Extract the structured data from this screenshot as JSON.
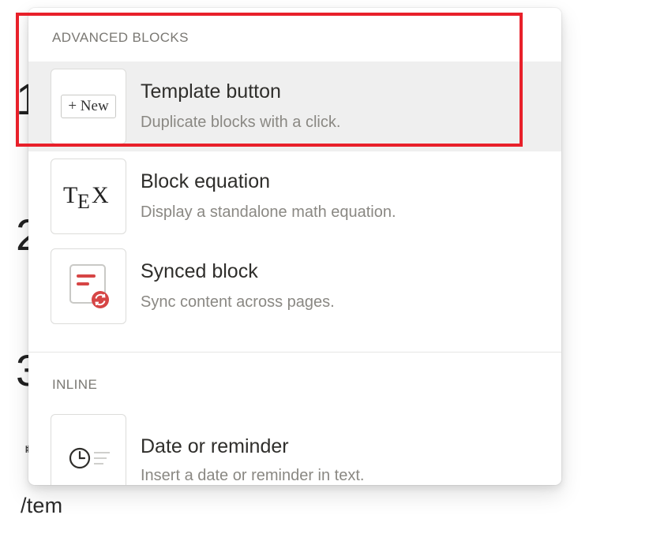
{
  "background": {
    "glyphs": [
      "1",
      "2",
      "3"
    ],
    "small_glyph": "ᅤ",
    "typed_text": "/tem"
  },
  "menu": {
    "sections": [
      {
        "header": "ADVANCED BLOCKS",
        "items": [
          {
            "title": "Template button",
            "description": "Duplicate blocks with a click.",
            "icon": "template-button-icon",
            "icon_text": "+ New",
            "selected": true
          },
          {
            "title": "Block equation",
            "description": "Display a standalone math equation.",
            "icon": "tex-equation-icon",
            "icon_text": "TEX",
            "selected": false
          },
          {
            "title": "Synced block",
            "description": "Sync content across pages.",
            "icon": "synced-block-icon",
            "selected": false
          }
        ]
      },
      {
        "header": "INLINE",
        "items": [
          {
            "title": "Date or reminder",
            "description": "Insert a date or reminder in text.",
            "icon": "clock-icon",
            "selected": false
          }
        ]
      }
    ]
  },
  "colors": {
    "highlight_border": "#e8202a",
    "selected_bg": "#efefef",
    "synced_accent": "#d64545"
  }
}
